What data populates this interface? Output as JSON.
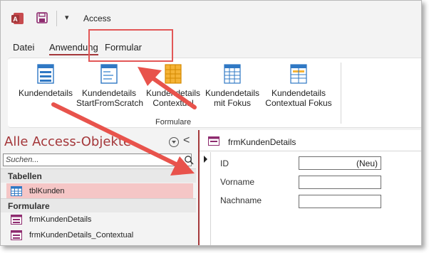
{
  "window": {
    "title": "Access"
  },
  "qat": {
    "dropdown_glyph": "▾"
  },
  "tabs": [
    {
      "label": "Datei"
    },
    {
      "label": "Anwendung",
      "active": true
    },
    {
      "label": "Formular"
    }
  ],
  "ribbon": {
    "buttons": [
      {
        "line1": "Kundendetails",
        "line2": ""
      },
      {
        "line1": "Kundendetails",
        "line2": "StartFromScratch"
      },
      {
        "line1": "Kundendetails",
        "line2": "Contextual"
      },
      {
        "line1": "Kundendetails",
        "line2": "mit Fokus"
      },
      {
        "line1": "Kundendetails",
        "line2": "Contextual Fokus"
      }
    ],
    "group_label": "Formulare"
  },
  "nav": {
    "title": "Alle Access-Objekte",
    "collapse_glyph": "<",
    "search_placeholder": "Suchen...",
    "categories": [
      {
        "label": "Tabellen",
        "items": [
          {
            "label": "tblKunden",
            "selected": true
          }
        ]
      },
      {
        "label": "Formulare",
        "items": [
          {
            "label": "frmKundenDetails"
          },
          {
            "label": "frmKundenDetails_Contextual"
          }
        ]
      }
    ]
  },
  "document": {
    "tab_label": "frmKundenDetails",
    "fields": [
      {
        "label": "ID",
        "value": "(Neu)"
      },
      {
        "label": "Vorname",
        "value": ""
      },
      {
        "label": "Nachname",
        "value": ""
      }
    ]
  },
  "colors": {
    "accent": "#a4373a",
    "highlight": "#e25757",
    "selected_row": "#f5c6c6"
  }
}
